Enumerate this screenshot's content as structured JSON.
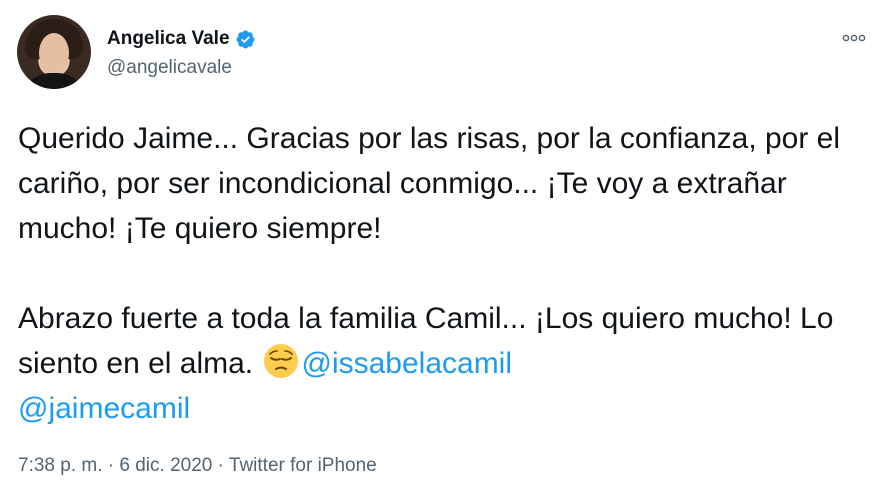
{
  "author": {
    "name": "Angelica Vale",
    "handle": "@angelicavale",
    "verified": true
  },
  "menu": {
    "more_label": "ooo"
  },
  "tweet": {
    "paragraph1": "Querido Jaime... Gracias por las risas, por la confianza, por el cariño, por ser incondicional conmigo... ¡Te voy a extrañar mucho! ¡Te quiero siempre!",
    "paragraph2_text": "Abrazo fuerte a toda la familia Camil... ¡Los quiero mucho! Lo siento en el alma.",
    "emoji": "pensive-face-icon",
    "mention1": "@issabelacamil",
    "mention2": "@jaimecamil"
  },
  "meta": {
    "time": "7:38 p. m.",
    "separator1": " · ",
    "date": "6 dic. 2020",
    "separator2": " · ",
    "source": "Twitter for iPhone"
  },
  "colors": {
    "text": "#0f1419",
    "secondary": "#536471",
    "link": "#1d9bf0",
    "verified": "#1d9bf0"
  }
}
